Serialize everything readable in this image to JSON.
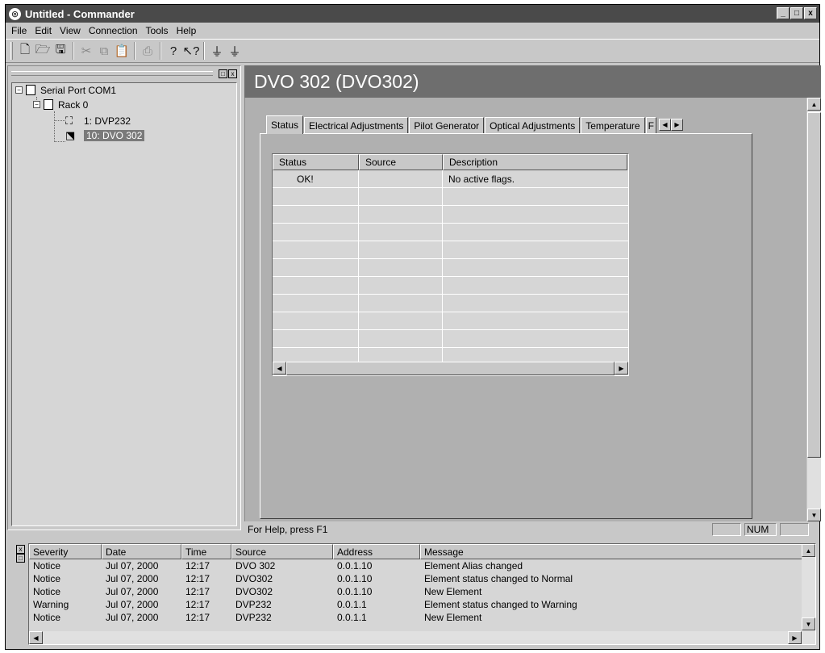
{
  "window": {
    "title": "Untitled - Commander",
    "minimize": "_",
    "maximize": "□",
    "close": "x"
  },
  "menu": [
    "File",
    "Edit",
    "View",
    "Connection",
    "Tools",
    "Help"
  ],
  "toolbar": {
    "icons": [
      "new-document-icon",
      "open-folder-icon",
      "save-icon",
      "cut-icon",
      "copy-icon",
      "paste-icon",
      "print-icon",
      "help-icon",
      "context-help-icon",
      "filter-icon",
      "filter-all-icon"
    ]
  },
  "tree": {
    "root": "Serial Port COM1",
    "rack": "Rack  0",
    "items": [
      "1: DVP232",
      "10: DVO 302"
    ],
    "selected_index": 1
  },
  "device_header": "DVO 302 (DVO302)",
  "tabs": [
    "Status",
    "Electrical Adjustments",
    "Pilot Generator",
    "Optical Adjustments",
    "Temperature",
    "F"
  ],
  "active_tab": "Status",
  "status_grid": {
    "columns": [
      "Status",
      "Source",
      "Description"
    ],
    "rows": [
      {
        "status": "OK!",
        "source": "",
        "description": "No active flags."
      }
    ],
    "empty_rows": 10
  },
  "statusbar": {
    "help_text": "For Help, press F1",
    "num": "NUM"
  },
  "log": {
    "columns": [
      "Severity",
      "Date",
      "Time",
      "Source",
      "Address",
      "Message"
    ],
    "rows": [
      {
        "severity": "Notice",
        "date": "Jul 07, 2000",
        "time": "12:17",
        "source": "DVO 302",
        "address": "0.0.1.10",
        "message": "Element Alias changed"
      },
      {
        "severity": "Notice",
        "date": "Jul 07, 2000",
        "time": "12:17",
        "source": "DVO302",
        "address": "0.0.1.10",
        "message": "Element status changed to Normal"
      },
      {
        "severity": "Notice",
        "date": "Jul 07, 2000",
        "time": "12:17",
        "source": "DVO302",
        "address": "0.0.1.10",
        "message": "New Element"
      },
      {
        "severity": "Warning",
        "date": "Jul 07, 2000",
        "time": "12:17",
        "source": "DVP232",
        "address": "0.0.1.1",
        "message": "Element status changed to Warning"
      },
      {
        "severity": "Notice",
        "date": "Jul 07, 2000",
        "time": "12:17",
        "source": "DVP232",
        "address": "0.0.1.1",
        "message": "New Element"
      }
    ]
  },
  "colors": {
    "window_bg": "#c8c8c8",
    "title_bg": "#4a4a4a",
    "header_bg": "#6e6e6e",
    "selection_bg": "#7a7a7a"
  }
}
